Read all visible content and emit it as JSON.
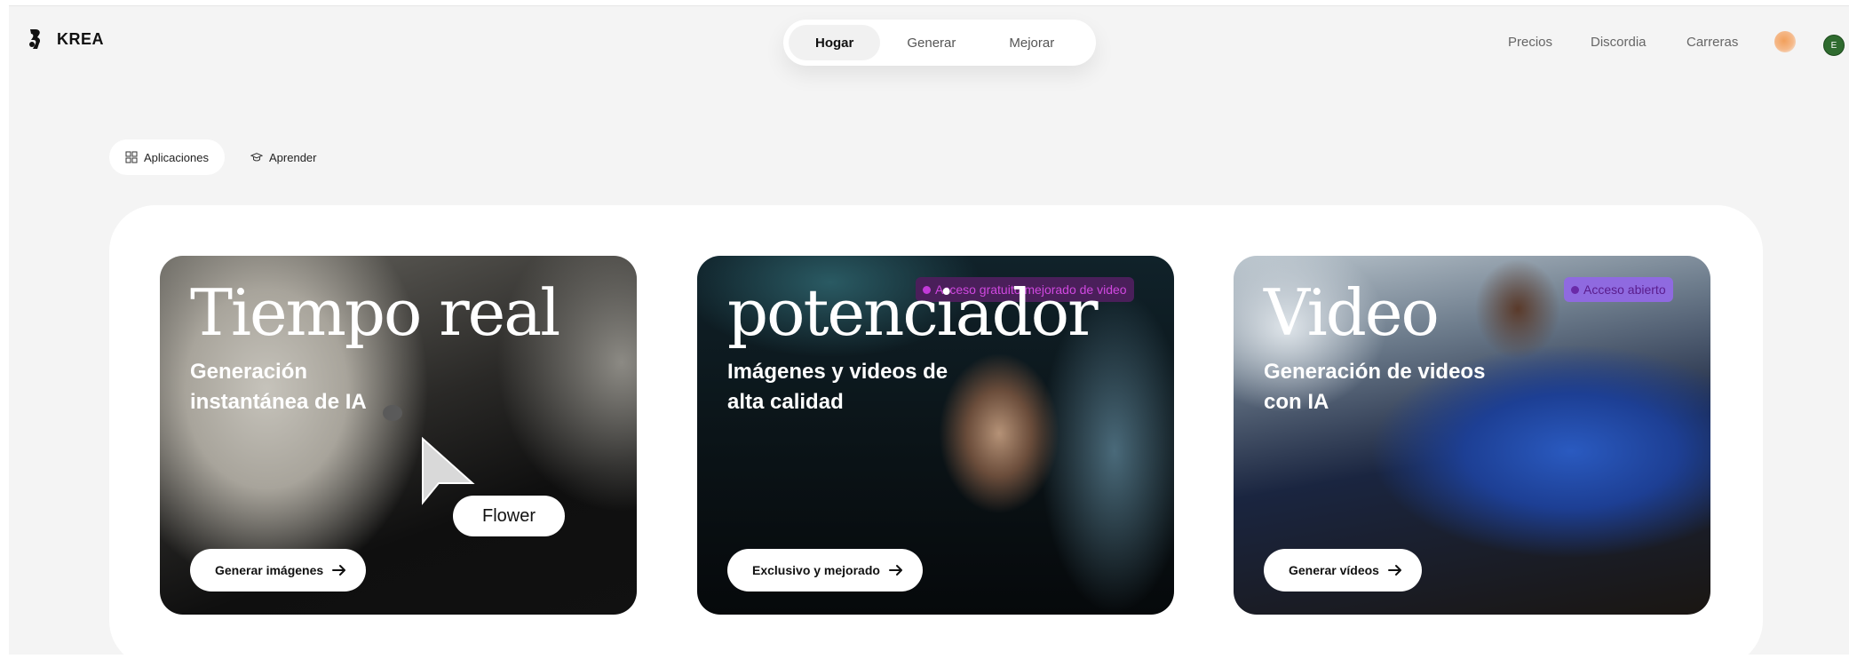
{
  "brand": {
    "name": "KREA"
  },
  "topnav": {
    "tabs": [
      {
        "label": "Hogar"
      },
      {
        "label": "Generar"
      },
      {
        "label": "Mejorar"
      }
    ]
  },
  "rightnav": {
    "links": [
      {
        "label": "Precios"
      },
      {
        "label": "Discordia"
      },
      {
        "label": "Carreras"
      }
    ],
    "user_initial": "E"
  },
  "subtabs": [
    {
      "label": "Aplicaciones"
    },
    {
      "label": "Aprender"
    }
  ],
  "cards": [
    {
      "title": "Tiempo real",
      "subtitle": "Generación instantánea de IA",
      "button": "Generar imágenes",
      "cursor_label": "Flower"
    },
    {
      "title": "potenciador",
      "subtitle": "Imágenes y videos de alta calidad",
      "button": "Exclusivo y mejorado",
      "badge": "Acceso gratuito mejorado de video"
    },
    {
      "title": "Video",
      "subtitle": "Generación de videos con IA",
      "button": "Generar vídeos",
      "badge": "Acceso abierto"
    }
  ],
  "icons": {
    "logo": "krea-logo-icon",
    "apps": "grid-icon",
    "learn": "graduation-cap-icon",
    "arrow": "arrow-right-icon",
    "cursor": "cursor-arrow-icon"
  },
  "colors": {
    "page_bg": "#f4f4f4",
    "card2_badge": "#c23ad8",
    "card3_badge": "#8f6ae0",
    "avatar": "#2f6b2f"
  }
}
